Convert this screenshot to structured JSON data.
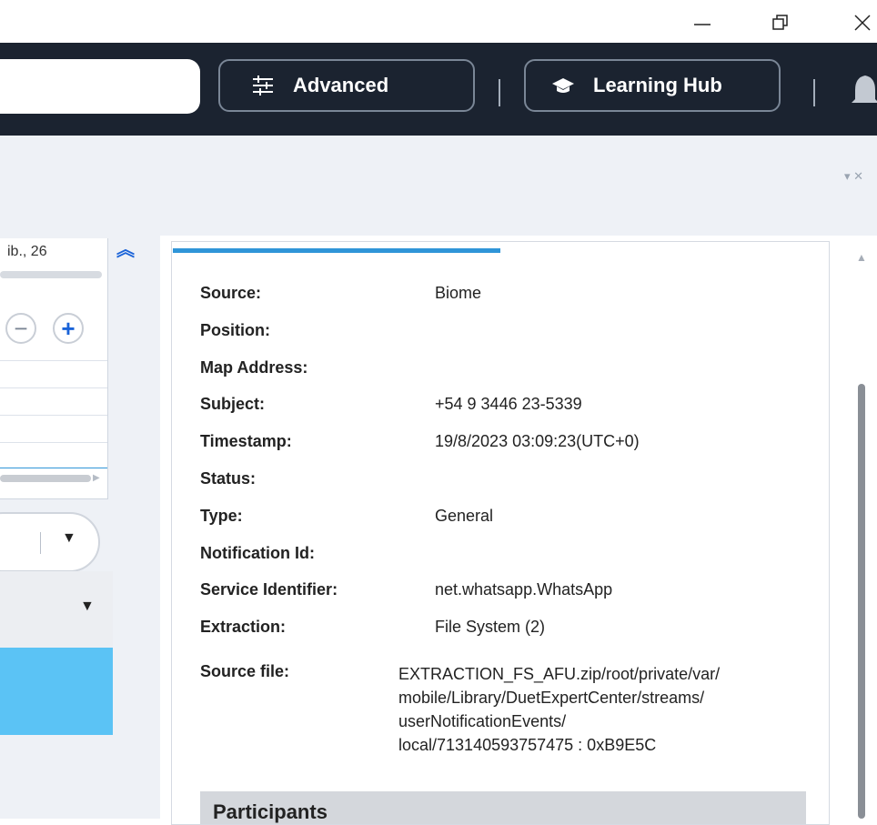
{
  "window": {
    "minimize": "—",
    "maximize": "⧉",
    "close": "✕"
  },
  "toolbar": {
    "advanced_label": "Advanced",
    "learning_hub_label": "Learning Hub"
  },
  "left_panel": {
    "date_fragment": "ib., 26",
    "zoom_out": "−",
    "zoom_in": "+"
  },
  "details": {
    "fields": [
      {
        "key": "Source:",
        "value": "Biome"
      },
      {
        "key": "Position:",
        "value": ""
      },
      {
        "key": "Map Address:",
        "value": ""
      },
      {
        "key": "Subject:",
        "value": "+54 9 3446 23-5339"
      },
      {
        "key": "Timestamp:",
        "value": "19/8/2023 03:09:23(UTC+0)"
      },
      {
        "key": "Status:",
        "value": ""
      },
      {
        "key": "Type:",
        "value": "General"
      },
      {
        "key": "Notification Id:",
        "value": ""
      },
      {
        "key": "Service Identifier:",
        "value": "net.whatsapp.WhatsApp"
      },
      {
        "key": "Extraction:",
        "value": "File System (2)"
      }
    ],
    "source_file_label": "Source file:",
    "source_file_lines": [
      "EXTRACTION_FS_AFU.zip/root/private/var/",
      "mobile/Library/DuetExpertCenter/streams/",
      "userNotificationEvents/",
      "local/713140593757475 : 0xB9E5C"
    ],
    "participants_header": "Participants"
  },
  "colors": {
    "toolbar_bg": "#1b2330",
    "accent": "#2f95d8",
    "selection": "#5bc3f5"
  }
}
